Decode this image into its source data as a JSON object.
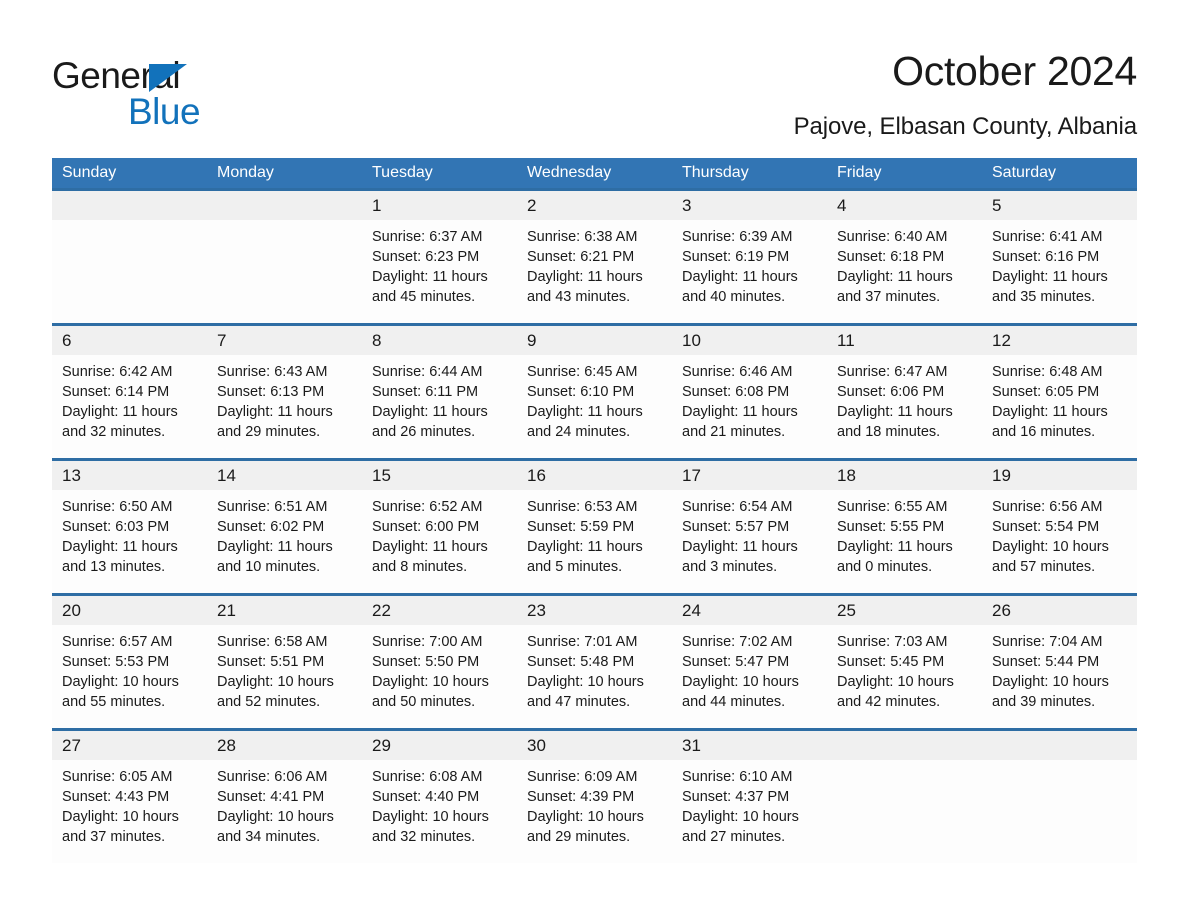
{
  "brand": {
    "name_part1": "General",
    "name_part2": "Blue",
    "triangle_color": "#1272bb"
  },
  "header": {
    "title": "October 2024",
    "location": "Pajove, Elbasan County, Albania"
  },
  "theme": {
    "header_blue": "#3275b4",
    "row_divider_blue": "#2e6da4",
    "date_band_gray": "#f0f0f0",
    "text_color": "#1a1a1a"
  },
  "weekdays": [
    "Sunday",
    "Monday",
    "Tuesday",
    "Wednesday",
    "Thursday",
    "Friday",
    "Saturday"
  ],
  "labels": {
    "sunrise_prefix": "Sunrise: ",
    "sunset_prefix": "Sunset: ",
    "daylight_prefix": "Daylight: "
  },
  "weeks": [
    {
      "days": [
        {
          "date": "",
          "sunrise": "",
          "sunset": "",
          "daylight_line1": "",
          "daylight_line2": ""
        },
        {
          "date": "",
          "sunrise": "",
          "sunset": "",
          "daylight_line1": "",
          "daylight_line2": ""
        },
        {
          "date": "1",
          "sunrise": "Sunrise: 6:37 AM",
          "sunset": "Sunset: 6:23 PM",
          "daylight_line1": "Daylight: 11 hours",
          "daylight_line2": "and 45 minutes."
        },
        {
          "date": "2",
          "sunrise": "Sunrise: 6:38 AM",
          "sunset": "Sunset: 6:21 PM",
          "daylight_line1": "Daylight: 11 hours",
          "daylight_line2": "and 43 minutes."
        },
        {
          "date": "3",
          "sunrise": "Sunrise: 6:39 AM",
          "sunset": "Sunset: 6:19 PM",
          "daylight_line1": "Daylight: 11 hours",
          "daylight_line2": "and 40 minutes."
        },
        {
          "date": "4",
          "sunrise": "Sunrise: 6:40 AM",
          "sunset": "Sunset: 6:18 PM",
          "daylight_line1": "Daylight: 11 hours",
          "daylight_line2": "and 37 minutes."
        },
        {
          "date": "5",
          "sunrise": "Sunrise: 6:41 AM",
          "sunset": "Sunset: 6:16 PM",
          "daylight_line1": "Daylight: 11 hours",
          "daylight_line2": "and 35 minutes."
        }
      ]
    },
    {
      "days": [
        {
          "date": "6",
          "sunrise": "Sunrise: 6:42 AM",
          "sunset": "Sunset: 6:14 PM",
          "daylight_line1": "Daylight: 11 hours",
          "daylight_line2": "and 32 minutes."
        },
        {
          "date": "7",
          "sunrise": "Sunrise: 6:43 AM",
          "sunset": "Sunset: 6:13 PM",
          "daylight_line1": "Daylight: 11 hours",
          "daylight_line2": "and 29 minutes."
        },
        {
          "date": "8",
          "sunrise": "Sunrise: 6:44 AM",
          "sunset": "Sunset: 6:11 PM",
          "daylight_line1": "Daylight: 11 hours",
          "daylight_line2": "and 26 minutes."
        },
        {
          "date": "9",
          "sunrise": "Sunrise: 6:45 AM",
          "sunset": "Sunset: 6:10 PM",
          "daylight_line1": "Daylight: 11 hours",
          "daylight_line2": "and 24 minutes."
        },
        {
          "date": "10",
          "sunrise": "Sunrise: 6:46 AM",
          "sunset": "Sunset: 6:08 PM",
          "daylight_line1": "Daylight: 11 hours",
          "daylight_line2": "and 21 minutes."
        },
        {
          "date": "11",
          "sunrise": "Sunrise: 6:47 AM",
          "sunset": "Sunset: 6:06 PM",
          "daylight_line1": "Daylight: 11 hours",
          "daylight_line2": "and 18 minutes."
        },
        {
          "date": "12",
          "sunrise": "Sunrise: 6:48 AM",
          "sunset": "Sunset: 6:05 PM",
          "daylight_line1": "Daylight: 11 hours",
          "daylight_line2": "and 16 minutes."
        }
      ]
    },
    {
      "days": [
        {
          "date": "13",
          "sunrise": "Sunrise: 6:50 AM",
          "sunset": "Sunset: 6:03 PM",
          "daylight_line1": "Daylight: 11 hours",
          "daylight_line2": "and 13 minutes."
        },
        {
          "date": "14",
          "sunrise": "Sunrise: 6:51 AM",
          "sunset": "Sunset: 6:02 PM",
          "daylight_line1": "Daylight: 11 hours",
          "daylight_line2": "and 10 minutes."
        },
        {
          "date": "15",
          "sunrise": "Sunrise: 6:52 AM",
          "sunset": "Sunset: 6:00 PM",
          "daylight_line1": "Daylight: 11 hours",
          "daylight_line2": "and 8 minutes."
        },
        {
          "date": "16",
          "sunrise": "Sunrise: 6:53 AM",
          "sunset": "Sunset: 5:59 PM",
          "daylight_line1": "Daylight: 11 hours",
          "daylight_line2": "and 5 minutes."
        },
        {
          "date": "17",
          "sunrise": "Sunrise: 6:54 AM",
          "sunset": "Sunset: 5:57 PM",
          "daylight_line1": "Daylight: 11 hours",
          "daylight_line2": "and 3 minutes."
        },
        {
          "date": "18",
          "sunrise": "Sunrise: 6:55 AM",
          "sunset": "Sunset: 5:55 PM",
          "daylight_line1": "Daylight: 11 hours",
          "daylight_line2": "and 0 minutes."
        },
        {
          "date": "19",
          "sunrise": "Sunrise: 6:56 AM",
          "sunset": "Sunset: 5:54 PM",
          "daylight_line1": "Daylight: 10 hours",
          "daylight_line2": "and 57 minutes."
        }
      ]
    },
    {
      "days": [
        {
          "date": "20",
          "sunrise": "Sunrise: 6:57 AM",
          "sunset": "Sunset: 5:53 PM",
          "daylight_line1": "Daylight: 10 hours",
          "daylight_line2": "and 55 minutes."
        },
        {
          "date": "21",
          "sunrise": "Sunrise: 6:58 AM",
          "sunset": "Sunset: 5:51 PM",
          "daylight_line1": "Daylight: 10 hours",
          "daylight_line2": "and 52 minutes."
        },
        {
          "date": "22",
          "sunrise": "Sunrise: 7:00 AM",
          "sunset": "Sunset: 5:50 PM",
          "daylight_line1": "Daylight: 10 hours",
          "daylight_line2": "and 50 minutes."
        },
        {
          "date": "23",
          "sunrise": "Sunrise: 7:01 AM",
          "sunset": "Sunset: 5:48 PM",
          "daylight_line1": "Daylight: 10 hours",
          "daylight_line2": "and 47 minutes."
        },
        {
          "date": "24",
          "sunrise": "Sunrise: 7:02 AM",
          "sunset": "Sunset: 5:47 PM",
          "daylight_line1": "Daylight: 10 hours",
          "daylight_line2": "and 44 minutes."
        },
        {
          "date": "25",
          "sunrise": "Sunrise: 7:03 AM",
          "sunset": "Sunset: 5:45 PM",
          "daylight_line1": "Daylight: 10 hours",
          "daylight_line2": "and 42 minutes."
        },
        {
          "date": "26",
          "sunrise": "Sunrise: 7:04 AM",
          "sunset": "Sunset: 5:44 PM",
          "daylight_line1": "Daylight: 10 hours",
          "daylight_line2": "and 39 minutes."
        }
      ]
    },
    {
      "days": [
        {
          "date": "27",
          "sunrise": "Sunrise: 6:05 AM",
          "sunset": "Sunset: 4:43 PM",
          "daylight_line1": "Daylight: 10 hours",
          "daylight_line2": "and 37 minutes."
        },
        {
          "date": "28",
          "sunrise": "Sunrise: 6:06 AM",
          "sunset": "Sunset: 4:41 PM",
          "daylight_line1": "Daylight: 10 hours",
          "daylight_line2": "and 34 minutes."
        },
        {
          "date": "29",
          "sunrise": "Sunrise: 6:08 AM",
          "sunset": "Sunset: 4:40 PM",
          "daylight_line1": "Daylight: 10 hours",
          "daylight_line2": "and 32 minutes."
        },
        {
          "date": "30",
          "sunrise": "Sunrise: 6:09 AM",
          "sunset": "Sunset: 4:39 PM",
          "daylight_line1": "Daylight: 10 hours",
          "daylight_line2": "and 29 minutes."
        },
        {
          "date": "31",
          "sunrise": "Sunrise: 6:10 AM",
          "sunset": "Sunset: 4:37 PM",
          "daylight_line1": "Daylight: 10 hours",
          "daylight_line2": "and 27 minutes."
        },
        {
          "date": "",
          "sunrise": "",
          "sunset": "",
          "daylight_line1": "",
          "daylight_line2": ""
        },
        {
          "date": "",
          "sunrise": "",
          "sunset": "",
          "daylight_line1": "",
          "daylight_line2": ""
        }
      ]
    }
  ]
}
